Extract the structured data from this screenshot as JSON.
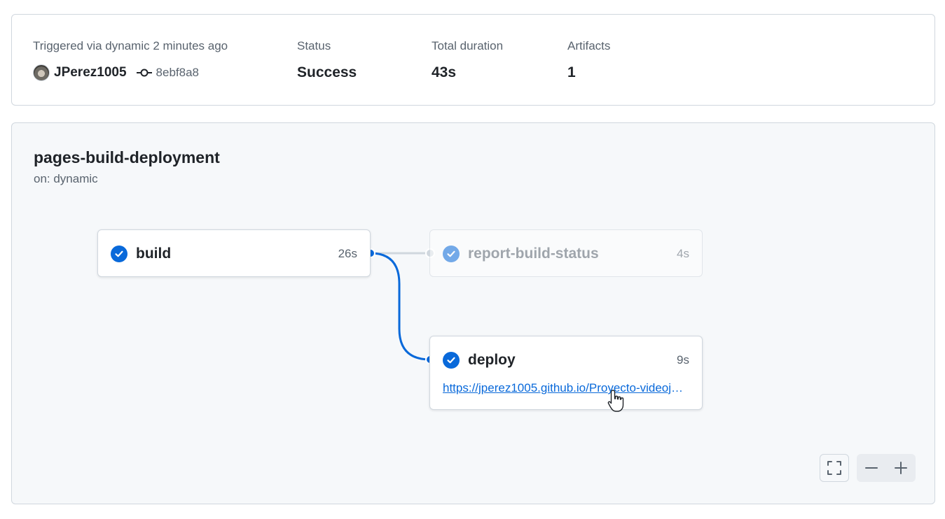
{
  "summary": {
    "trigger_label": "Triggered via dynamic 2 minutes ago",
    "actor": "JPerez1005",
    "commit_sha": "8ebf8a8",
    "status_label": "Status",
    "status_value": "Success",
    "duration_label": "Total duration",
    "duration_value": "43s",
    "artifacts_label": "Artifacts",
    "artifacts_value": "1"
  },
  "workflow": {
    "title": "pages-build-deployment",
    "subtitle": "on: dynamic",
    "jobs": [
      {
        "name": "build",
        "duration": "26s",
        "status": "success"
      },
      {
        "name": "report-build-status",
        "duration": "4s",
        "status": "success"
      },
      {
        "name": "deploy",
        "duration": "9s",
        "status": "success",
        "link": "https://jperez1005.github.io/Proyecto-videojuego/"
      }
    ]
  },
  "colors": {
    "accent": "#0969da",
    "border": "#d0d7de",
    "canvas": "#f6f8fa",
    "muted_text": "#59636e"
  },
  "icons": {
    "success": "check-circle-icon",
    "commit": "git-commit-icon",
    "fullscreen": "screen-full-icon",
    "zoom_out": "dash-icon",
    "zoom_in": "plus-icon"
  }
}
